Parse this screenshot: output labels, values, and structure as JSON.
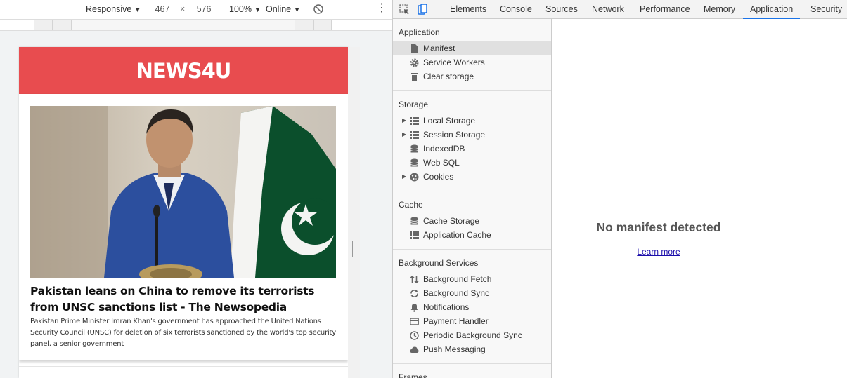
{
  "emulation_toolbar": {
    "device_label": "Responsive",
    "width": "467",
    "dimension_separator": "×",
    "height": "576",
    "zoom": "100%",
    "network": "Online",
    "menu_glyph": "⋮"
  },
  "page": {
    "logo": "NEWS4U",
    "article": {
      "title": "Pakistan leans on China to remove its terrorists from UNSC sanctions list - The Newsopedia",
      "description": "Pakistan Prime Minister Imran Khan's government has approached the United Nations Security Council (UNSC) for deletion of six terrorists sanctioned by the world's top security panel, a senior government"
    },
    "header_color": "#e84c4f"
  },
  "devtools": {
    "tabs": [
      "Elements",
      "Console",
      "Sources",
      "Network",
      "Performance",
      "Memory",
      "Application",
      "Security"
    ],
    "active_tab": "Application",
    "accent_color": "#1a73e8",
    "sidebar": {
      "application": {
        "title": "Application",
        "items": [
          "Manifest",
          "Service Workers",
          "Clear storage"
        ]
      },
      "storage": {
        "title": "Storage",
        "items": [
          "Local Storage",
          "Session Storage",
          "IndexedDB",
          "Web SQL",
          "Cookies"
        ]
      },
      "cache": {
        "title": "Cache",
        "items": [
          "Cache Storage",
          "Application Cache"
        ]
      },
      "background_services": {
        "title": "Background Services",
        "items": [
          "Background Fetch",
          "Background Sync",
          "Notifications",
          "Payment Handler",
          "Periodic Background Sync",
          "Push Messaging"
        ]
      },
      "frames": {
        "title": "Frames"
      }
    },
    "main": {
      "message": "No manifest detected",
      "link": "Learn more"
    }
  }
}
